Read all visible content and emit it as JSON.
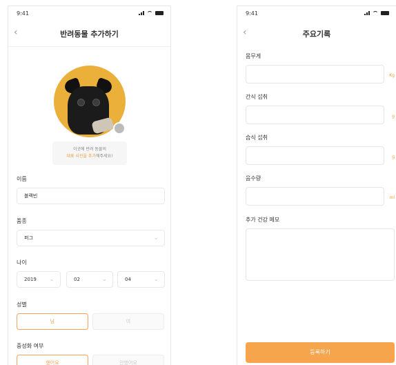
{
  "colors": {
    "accent": "#f7a54d",
    "accent_text": "#f39b3f",
    "avatar_bg": "#eab03a"
  },
  "screen1": {
    "time": "9:41",
    "title": "반려동물 추가하기",
    "back_icon": "chevron-left-icon",
    "hint": {
      "line1": "이곳에 반려 동물의",
      "accent": "대표 사진을 추가",
      "rest": "해주세요!"
    },
    "name": {
      "label": "이름",
      "value": "블랙빈"
    },
    "breed": {
      "label": "품종",
      "value": "퍼그"
    },
    "age": {
      "label": "나이",
      "year": "2019",
      "month": "02",
      "day": "04"
    },
    "gender": {
      "label": "성별",
      "options": [
        "남",
        "여"
      ]
    },
    "neutered": {
      "label": "중성화 여부",
      "options": [
        "했어요",
        "안했어요"
      ]
    }
  },
  "screen2": {
    "time": "9:41",
    "title": "주요기록",
    "back_icon": "chevron-left-icon",
    "fields": [
      {
        "label": "몸무게",
        "unit": "Kg"
      },
      {
        "label": "간식 섭취",
        "unit": "g"
      },
      {
        "label": "습식 섭취",
        "unit": "g"
      },
      {
        "label": "음수량",
        "unit": "ml"
      }
    ],
    "memo_label": "추가 건강 메모",
    "submit_label": "등록하기"
  }
}
